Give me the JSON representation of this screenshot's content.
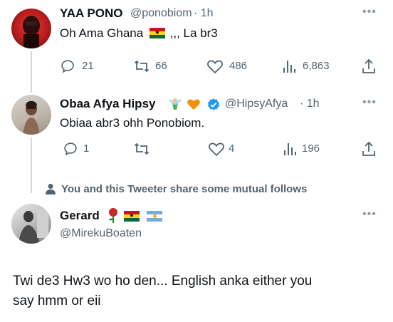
{
  "tweet1": {
    "name": "YAA PONO",
    "handle": "@ponobiom",
    "time": "· 1h",
    "text": "Oh Ama Ghana",
    "text_suffix": ",,, La br3",
    "stats": {
      "replies": "21",
      "retweets": "66",
      "likes": "486",
      "views": "6,863"
    }
  },
  "tweet2": {
    "name": "Obaa Afya Hipsy",
    "handle": "@HipsyAfya",
    "time": "· 1h",
    "text": "Obiaa abr3 ohh Ponobiom.",
    "stats": {
      "replies": "1",
      "retweets": "",
      "likes": "4",
      "views": "196"
    }
  },
  "mutual_notice": "You and this Tweeter share some mutual follows",
  "tweet3": {
    "name": "Gerard",
    "handle": "@MirekuBoaten",
    "text_line1": "Twi de3 Hw3 wo ho den... English anka either you",
    "text_line2": "say hmm or eii"
  },
  "colors": {
    "text": "#0f1419",
    "muted": "#536471",
    "verified": "#1d9bf0",
    "line": "#cfd9de"
  }
}
